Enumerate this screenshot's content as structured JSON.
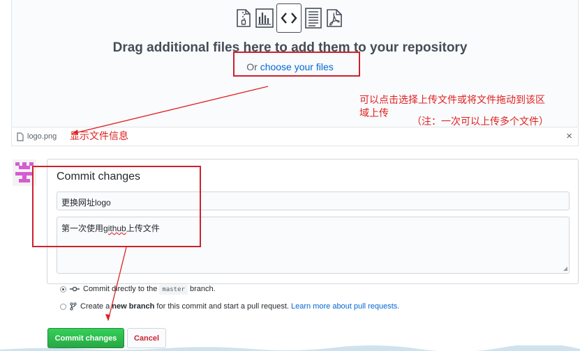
{
  "upload": {
    "drag_title": "Drag additional files here to add them to your repository",
    "or_prefix": "Or ",
    "choose_link": "choose your files"
  },
  "annotations": {
    "choose_note_line1": "可以点击选择上传文件或将文件拖动到该区",
    "choose_note_line2": "域上传",
    "multi_note": "（注：一次可以上传多个文件）",
    "file_info_note": "显示文件信息"
  },
  "file": {
    "name": "logo.png",
    "remove_symbol": "×"
  },
  "commit": {
    "title": "Commit changes",
    "summary_value": "更换网址logo",
    "description_prefix": "第一次使用",
    "description_word": "github",
    "description_suffix": "上传文件",
    "option_direct_prefix": "Commit directly to the ",
    "option_direct_branch": "master",
    "option_direct_suffix": " branch.",
    "option_new_prefix": "Create a ",
    "option_new_bold": "new branch",
    "option_new_suffix": " for this commit and start a pull request. ",
    "option_new_link": "Learn more about pull requests.",
    "submit_label": "Commit changes",
    "cancel_label": "Cancel"
  },
  "icons": [
    "file-zip-icon",
    "file-chart-icon",
    "file-code-icon",
    "file-text-icon",
    "file-pdf-icon",
    "commit-icon",
    "branch-icon",
    "file-icon",
    "close-icon"
  ],
  "colors": {
    "link": "#0366d6",
    "annotation_red": "#e02020",
    "commit_green": "#28a745",
    "cancel_red": "#cb2431"
  }
}
